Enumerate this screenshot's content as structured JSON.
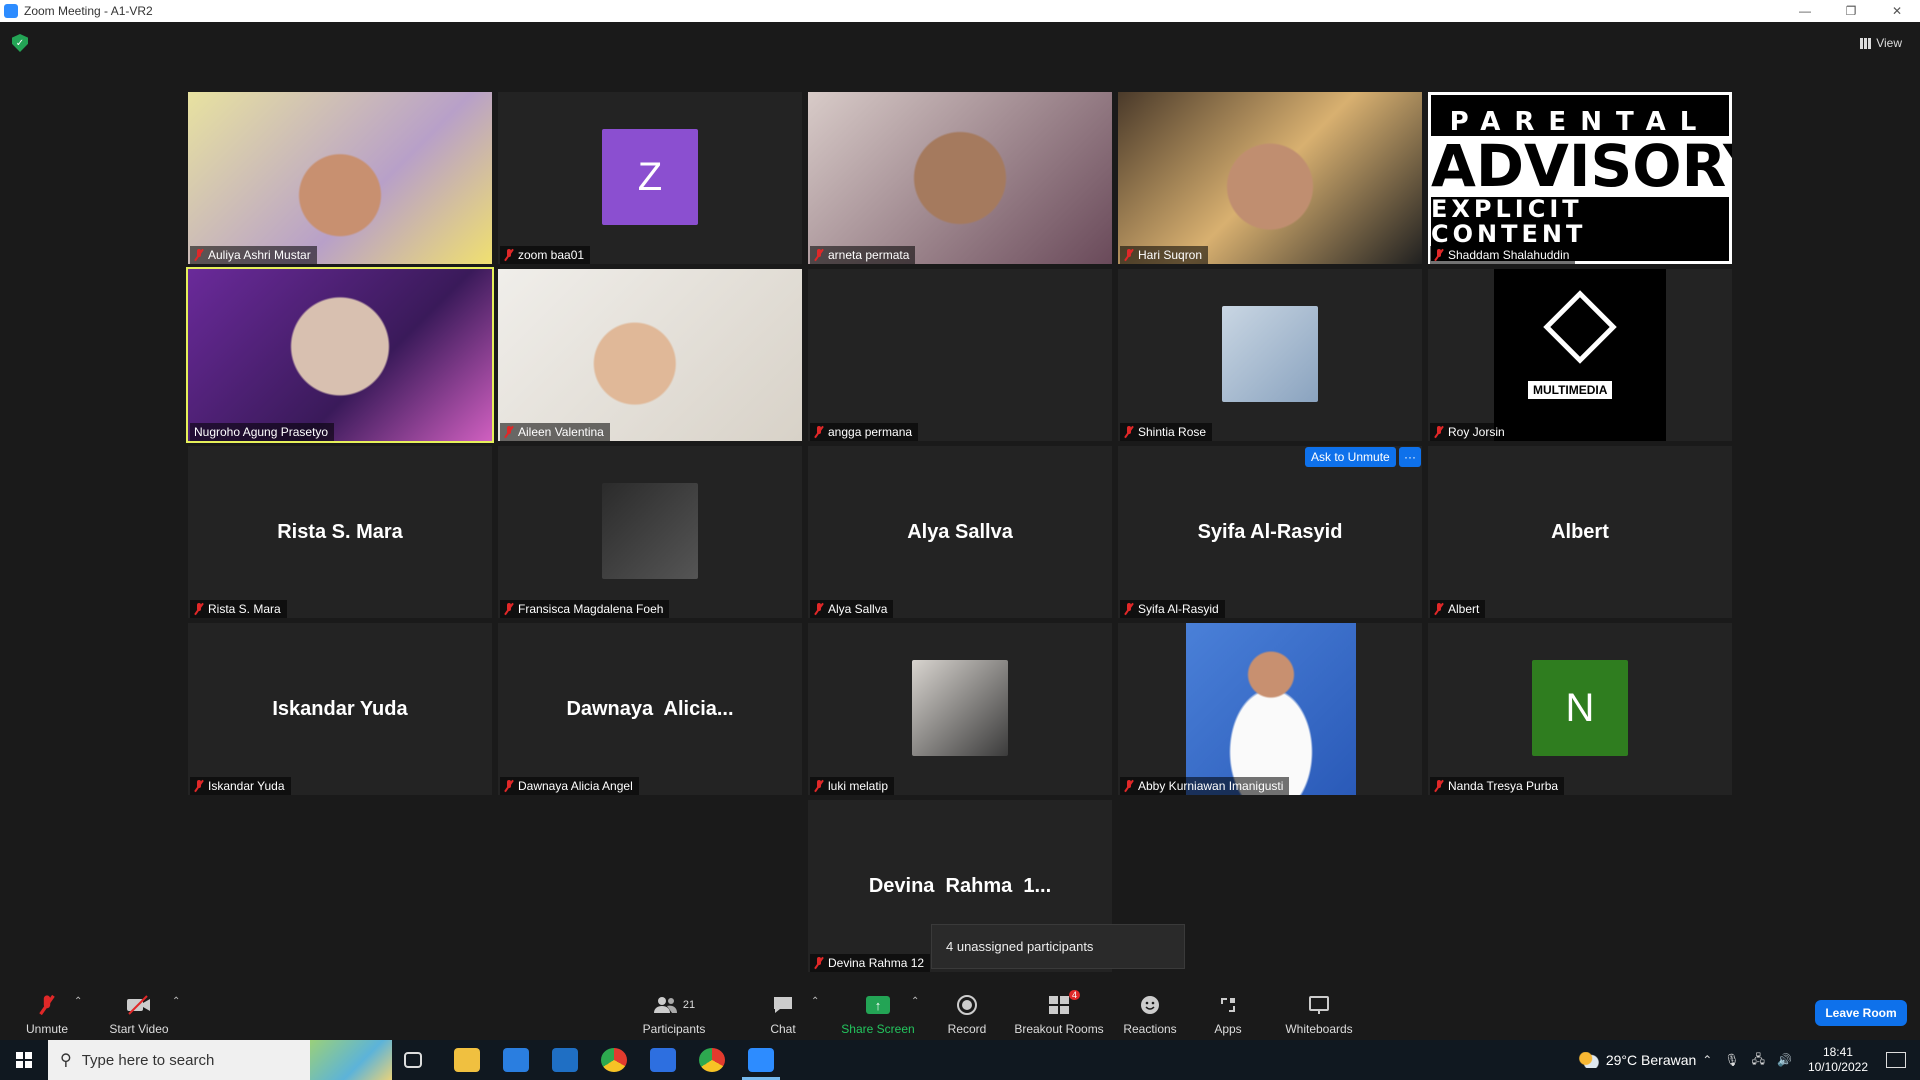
{
  "window": {
    "title": "Zoom Meeting - A1-VR2",
    "minimize": "—",
    "restore": "❐",
    "close": "✕"
  },
  "view_label": "View",
  "tiles": [
    {
      "name": "Auliya Ashri Mustar",
      "kind": "video"
    },
    {
      "name": "zoom baa01",
      "kind": "letter",
      "letter": "Z",
      "color": "#8b4fd0"
    },
    {
      "name": "arneta permata",
      "kind": "video"
    },
    {
      "name": "Hari Suqron",
      "kind": "video"
    },
    {
      "name": "Shaddam Shalahuddin",
      "kind": "advisory",
      "advisory": [
        "PARENTAL",
        "ADVISORY",
        "EXPLICIT CONTENT"
      ]
    },
    {
      "name": "Nugroho Agung Prasetyo",
      "kind": "video",
      "active": true
    },
    {
      "name": "Aileen Valentina",
      "kind": "video"
    },
    {
      "name": "angga permana",
      "kind": "blank"
    },
    {
      "name": "Shintia Rose",
      "kind": "photo"
    },
    {
      "name": "Roy Jorsin",
      "kind": "logo",
      "logo_text": "MULTIMEDIA"
    },
    {
      "name": "Rista S. Mara",
      "kind": "name",
      "display": "Rista S. Mara"
    },
    {
      "name": "Fransisca Magdalena Foeh",
      "kind": "photo"
    },
    {
      "name": "Alya Sallva",
      "kind": "name",
      "display": "Alya Sallva"
    },
    {
      "name": "Syifa Al-Rasyid",
      "kind": "name",
      "display": "Syifa Al-Rasyid"
    },
    {
      "name": "Albert",
      "kind": "name",
      "display": "Albert"
    },
    {
      "name": "Iskandar Yuda",
      "kind": "name",
      "display": "Iskandar Yuda"
    },
    {
      "name": "Dawnaya Alicia Angel",
      "kind": "name",
      "display": "Dawnaya  Alicia..."
    },
    {
      "name": "luki melatip",
      "kind": "photo"
    },
    {
      "name": "Abby Kurniawan Imanigusti",
      "kind": "video"
    },
    {
      "name": "Nanda Tresya Purba",
      "kind": "letter",
      "letter": "N",
      "color": "#2f7d1f"
    },
    {
      "name": "Devina Rahma 12",
      "kind": "name",
      "display": "Devina  Rahma  1..."
    }
  ],
  "hover_actions": {
    "ask_unmute": "Ask to Unmute",
    "more": "···"
  },
  "tooltip": "4 unassigned participants",
  "toolbar": {
    "unmute": "Unmute",
    "start_video": "Start Video",
    "participants": "Participants",
    "participants_count": "21",
    "chat": "Chat",
    "share_screen": "Share Screen",
    "record": "Record",
    "breakout_rooms": "Breakout Rooms",
    "breakout_badge": "4",
    "reactions": "Reactions",
    "apps": "Apps",
    "whiteboards": "Whiteboards",
    "leave": "Leave Room"
  },
  "taskbar": {
    "search_placeholder": "Type here to search",
    "weather": "29°C  Berawan",
    "time": "18:41",
    "date": "10/10/2022"
  }
}
